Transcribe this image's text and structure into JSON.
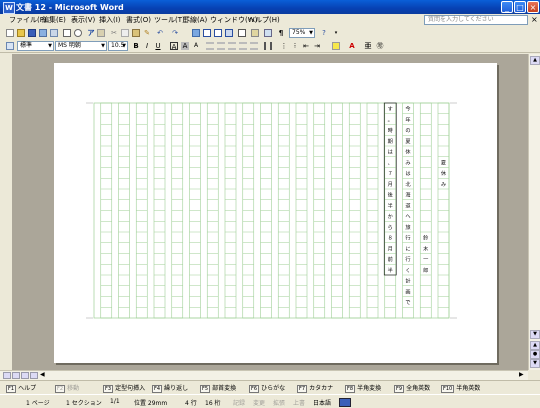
{
  "window": {
    "title": "文書 12 - Microsoft Word"
  },
  "menu": {
    "items": [
      "ファイル(F)",
      "編集(E)",
      "表示(V)",
      "挿入(I)",
      "書式(O)",
      "ツール(T)",
      "罫線(A)",
      "ウィンドウ(W)",
      "ヘルプ(H)"
    ],
    "help_placeholder": "質問を入力してください",
    "zoom": "75%"
  },
  "format": {
    "style": "標準",
    "font": "MS 明朝",
    "size": "10.5",
    "bold_label": "B",
    "italic_label": "I",
    "underline_label": "U",
    "char_border_label": "A",
    "char_shade_label": "A",
    "char_scale_label": "A"
  },
  "document": {
    "columns": [
      {
        "chars": "夏休み",
        "row_start": 5,
        "boxed": false
      },
      {
        "chars": "鈴木一郎",
        "row_start": 12,
        "boxed": false
      },
      {
        "chars": "今年の夏休みは北海道へ旅行に行く計画で",
        "row_start": 0,
        "boxed": false
      },
      {
        "chars": "す。時期は、７月後半から８月前半",
        "row_start": 0,
        "boxed": true
      }
    ]
  },
  "fkeys": [
    {
      "key": "F1",
      "label": "ヘルプ",
      "enabled": true
    },
    {
      "key": "F2",
      "label": "移動",
      "enabled": false
    },
    {
      "key": "F3",
      "label": "定型句挿入",
      "enabled": true
    },
    {
      "key": "F4",
      "label": "繰り返し",
      "enabled": true
    },
    {
      "key": "F5",
      "label": "部首変換",
      "enabled": true
    },
    {
      "key": "F6",
      "label": "ひらがな",
      "enabled": true
    },
    {
      "key": "F7",
      "label": "カタカナ",
      "enabled": true
    },
    {
      "key": "F8",
      "label": "半角変換",
      "enabled": true
    },
    {
      "key": "F9",
      "label": "全角英数",
      "enabled": true
    },
    {
      "key": "F10",
      "label": "半角英数",
      "enabled": true
    }
  ],
  "status": {
    "page": "1 ページ",
    "section": "1 セクション",
    "pages": "1/1",
    "position": "位置 29mm",
    "line": "4 行",
    "column": "16 桁",
    "rec": "記録",
    "trk": "変更",
    "ext": "拡張",
    "ovr": "上書",
    "lang": "日本語"
  },
  "colors": {
    "grid": "#9fcf96",
    "title_bar": "#0a5fd8"
  }
}
